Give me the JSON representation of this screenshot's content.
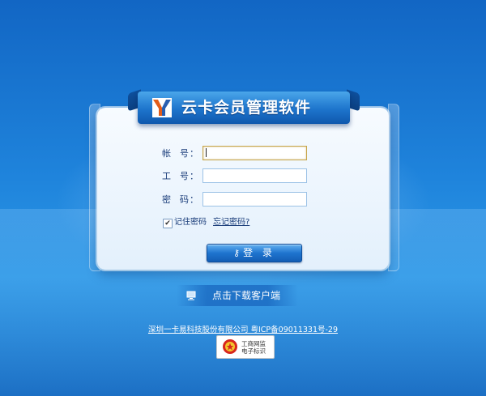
{
  "app": {
    "title": "云卡会员管理软件",
    "logo_icon": "yk-logo-icon"
  },
  "login": {
    "account_label_a": "帐",
    "account_label_b": "号",
    "staff_label_a": "工",
    "staff_label_b": "号",
    "password_label_a": "密",
    "password_label_b": "码",
    "colon": "：",
    "account_value": "",
    "staff_value": "",
    "password_value": "",
    "remember_label": "记住密码",
    "remember_checked": true,
    "forgot_label": "忘记密码?",
    "submit_label": "登 录",
    "submit_icon": "key-icon"
  },
  "download": {
    "label": "点击下载客户端",
    "icon": "computer-icon"
  },
  "footer": {
    "company_link": "深圳一卡易科技股份有限公司 粤ICP备09011331号-29",
    "badge_line1": "工商网监",
    "badge_line2": "电子标识",
    "badge_icon": "gov-seal-icon"
  },
  "colors": {
    "background": "#1f84dc",
    "ribbon": "#1d74cc",
    "panel": "#eef6fd",
    "label_text": "#1a3d7a"
  }
}
